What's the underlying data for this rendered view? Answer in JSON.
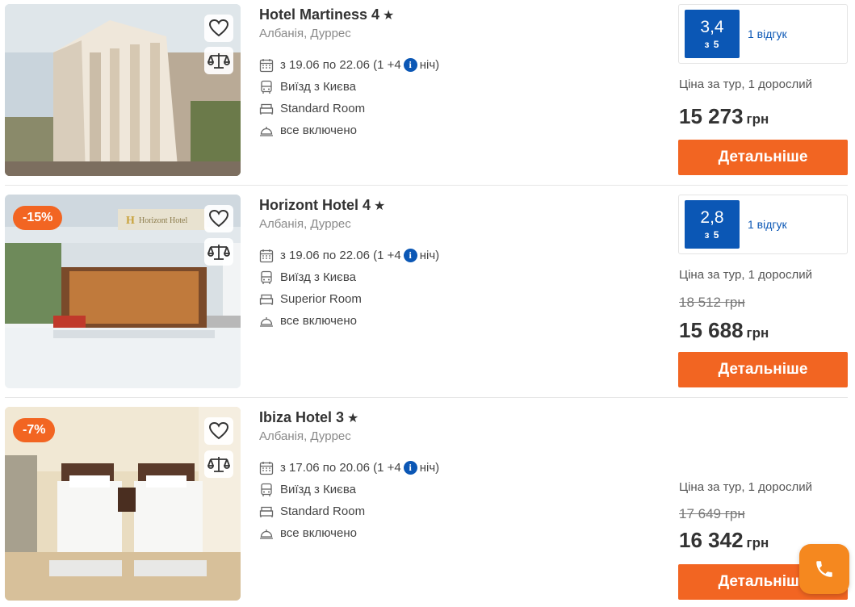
{
  "hotels": [
    {
      "name": "Hotel Martiness 4",
      "location": "Албанія, Дуррес",
      "dates_prefix": "з 19.06 по 22.06 (1 +4",
      "dates_suffix": "ніч)",
      "departure": "Виїзд з Києва",
      "room": "Standard Room",
      "meal": "все включено",
      "rating": "3,4",
      "rating_of": "з 5",
      "reviews": "1 відгук",
      "price_label": "Ціна за тур, 1 дорослий",
      "old_price": "",
      "price": "15 273",
      "currency": "грн",
      "button": "Детальніше",
      "discount": ""
    },
    {
      "name": "Horizont Hotel 4",
      "location": "Албанія, Дуррес",
      "dates_prefix": "з 19.06 по 22.06 (1 +4",
      "dates_suffix": "ніч)",
      "departure": "Виїзд з Києва",
      "room": "Superior Room",
      "meal": "все включено",
      "rating": "2,8",
      "rating_of": "з 5",
      "reviews": "1 відгук",
      "price_label": "Ціна за тур, 1 дорослий",
      "old_price": "18 512 грн",
      "price": "15 688",
      "currency": "грн",
      "button": "Детальніше",
      "discount": "-15%",
      "sign_text": "Horizont Hotel"
    },
    {
      "name": "Ibiza Hotel 3",
      "location": "Албанія, Дуррес",
      "dates_prefix": "з 17.06 по 20.06 (1 +4",
      "dates_suffix": "ніч)",
      "departure": "Виїзд з Києва",
      "room": "Standard Room",
      "meal": "все включено",
      "price_label": "Ціна за тур, 1 дорослий",
      "old_price": "17 649 грн",
      "price": "16 342",
      "currency": "грн",
      "button": "Детальніше",
      "discount": "-7%"
    }
  ],
  "colors": {
    "accent": "#f26522",
    "rating": "#0b57b5",
    "call": "#f5881f"
  },
  "icons": [
    "heart-icon",
    "scales-icon",
    "calendar-icon",
    "bus-icon",
    "bed-icon",
    "cloche-icon",
    "info-icon",
    "star-icon",
    "phone-icon"
  ]
}
